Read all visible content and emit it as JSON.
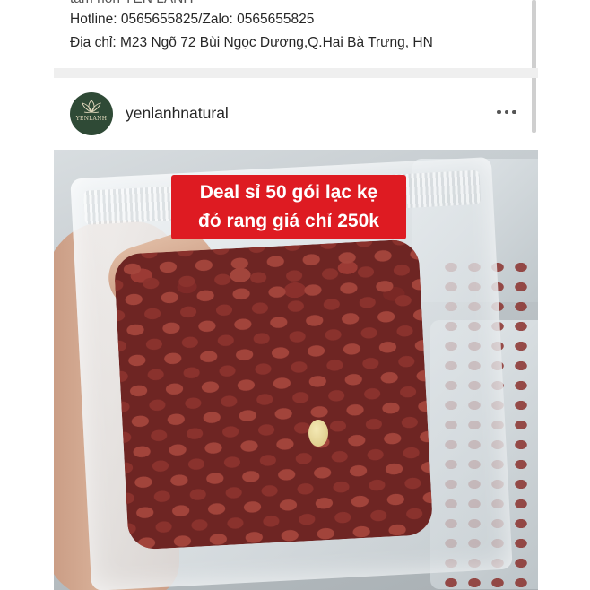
{
  "caption": {
    "cut_line": "tâm hồn YẾN LÀNH",
    "hotline": "Hotline: 0565655825/Zalo: 0565655825",
    "address": "Địa chỉ: M23 Ngõ 72 Bùi Ngọc Dương,Q.Hai Bà Trưng, HN"
  },
  "post": {
    "username": "yenlanhnatural",
    "avatar_text": "YENLANH",
    "more_icon": "more-horizontal-icon",
    "banner_line1": "Deal sỉ 50 gói lạc kẹ",
    "banner_line2": "đỏ rang giá chỉ 250k"
  },
  "colors": {
    "banner": "#de1b22",
    "avatar": "#2f4a36",
    "separator": "#efefef",
    "text": "#262626"
  }
}
